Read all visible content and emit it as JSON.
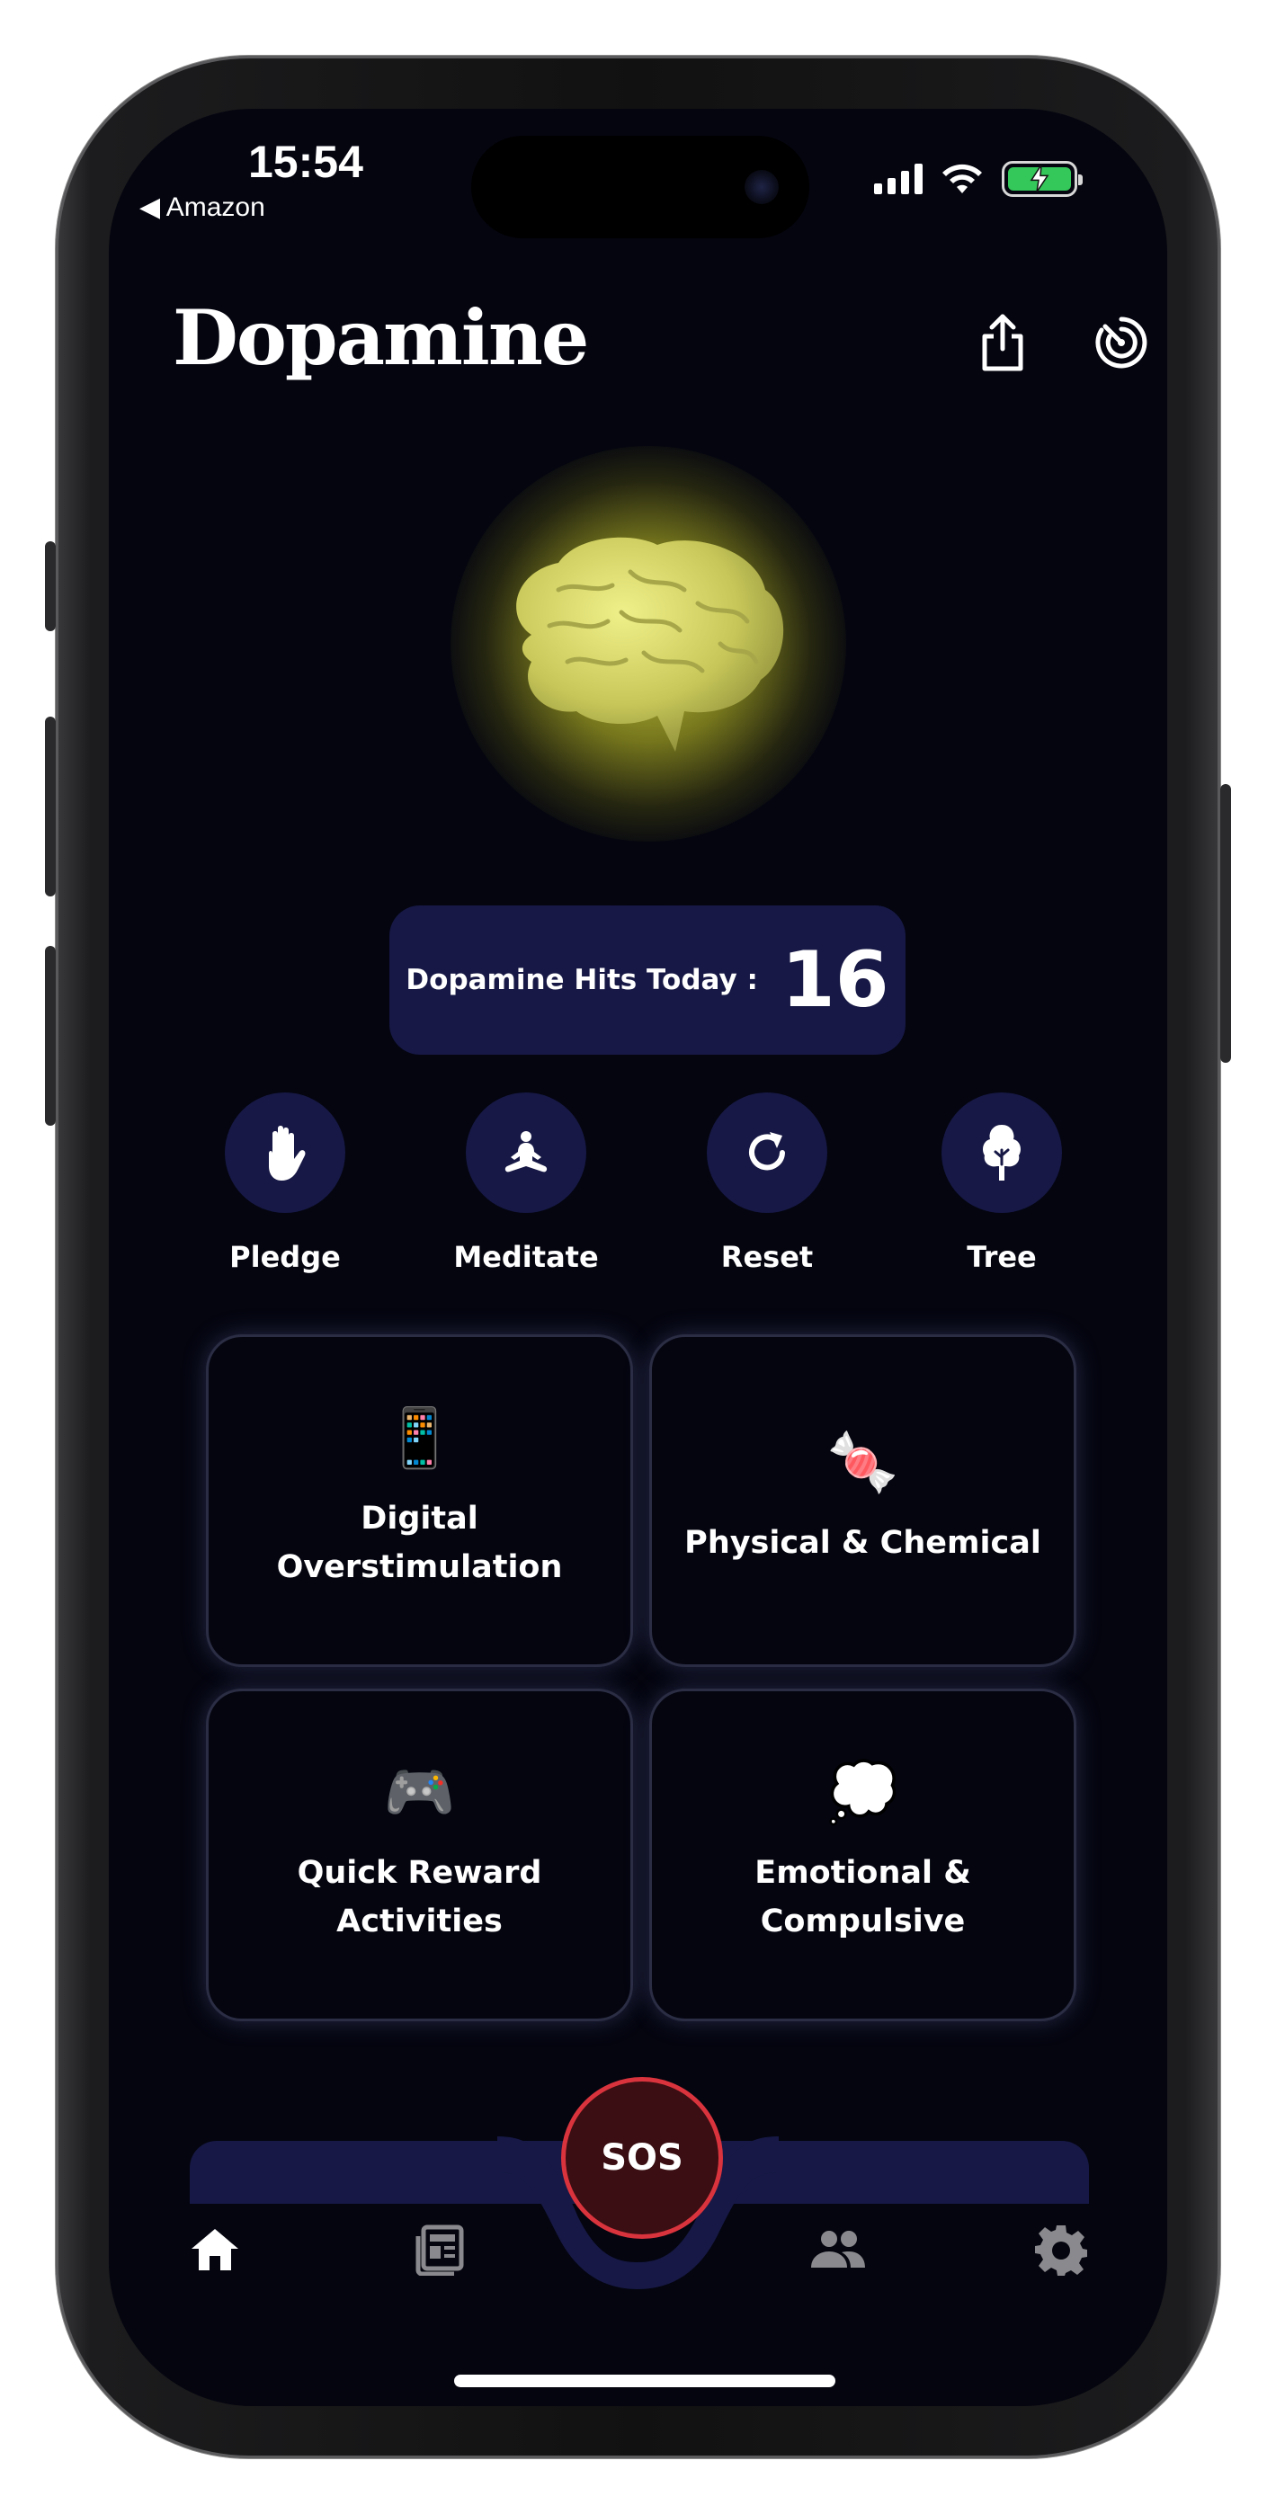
{
  "status": {
    "time": "15:54",
    "back_label": "◀ Amazon"
  },
  "header": {
    "title": "Dopamine"
  },
  "hits": {
    "label": "Dopamine Hits Today :",
    "count": "16"
  },
  "actions": [
    {
      "label": "Pledge",
      "icon": "hand-icon"
    },
    {
      "label": "Meditate",
      "icon": "meditate-icon"
    },
    {
      "label": "Reset",
      "icon": "refresh-icon"
    },
    {
      "label": "Tree",
      "icon": "tree-icon"
    }
  ],
  "categories": [
    {
      "emoji": "📱",
      "line1": "Digital",
      "line2": "Overstimulation"
    },
    {
      "emoji": "🍬",
      "line1": "Physical & Chemical",
      "line2": ""
    },
    {
      "emoji": "🎮",
      "line1": "Quick Reward",
      "line2": "Activities"
    },
    {
      "emoji": "💭",
      "line1": "Emotional &",
      "line2": "Compulsive"
    }
  ],
  "nav": {
    "sos_label": "SOS",
    "active": "home"
  },
  "colors": {
    "background": "#04050f",
    "accent": "#171845",
    "sos_red": "#d9343d",
    "glow": "#e6e646"
  }
}
